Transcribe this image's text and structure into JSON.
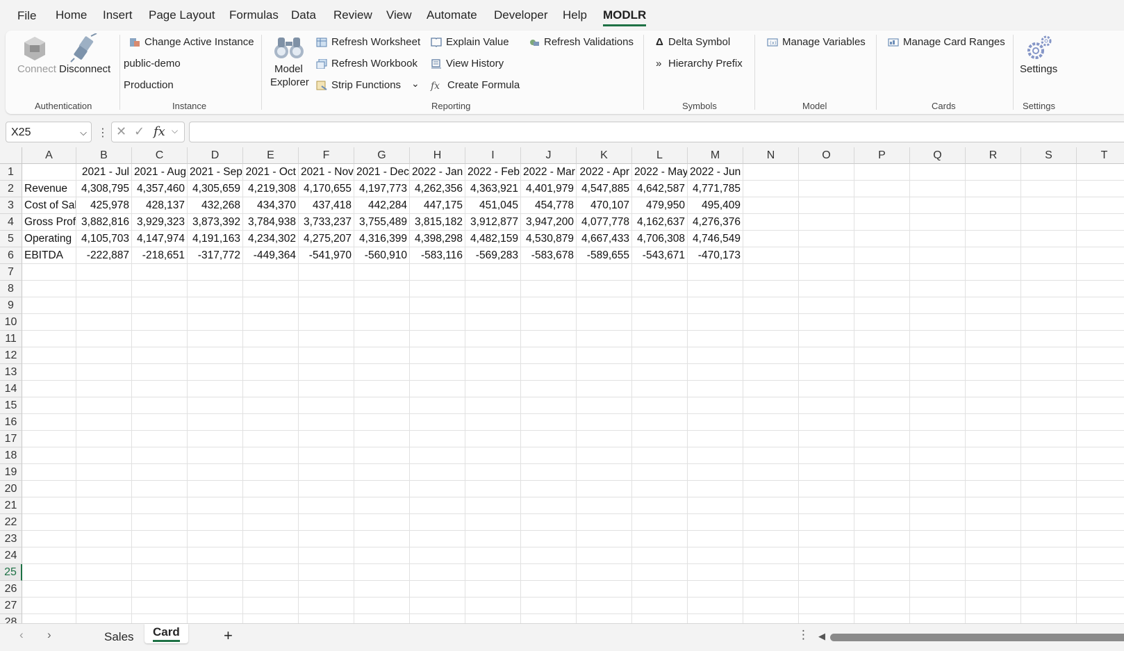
{
  "menu": {
    "items": [
      "File",
      "Home",
      "Insert",
      "Page Layout",
      "Formulas",
      "Data",
      "Review",
      "View",
      "Automate",
      "Developer",
      "Help",
      "MODLR"
    ],
    "active": "MODLR"
  },
  "ribbon": {
    "auth": {
      "connect": "Connect",
      "disconnect": "Disconnect",
      "label": "Authentication"
    },
    "instance": {
      "change": "Change Active Instance",
      "name": "public-demo",
      "env": "Production",
      "label": "Instance"
    },
    "reporting": {
      "model_explorer_1": "Model",
      "model_explorer_2": "Explorer",
      "refresh_worksheet": "Refresh Worksheet",
      "refresh_workbook": "Refresh Workbook",
      "strip_functions": "Strip Functions",
      "explain_value": "Explain Value",
      "view_history": "View History",
      "create_formula": "Create Formula",
      "refresh_validations": "Refresh Validations",
      "label": "Reporting"
    },
    "symbols": {
      "delta": "Delta Symbol",
      "hierarchy": "Hierarchy Prefix",
      "label": "Symbols"
    },
    "model": {
      "manage_variables": "Manage Variables",
      "label": "Model"
    },
    "cards": {
      "manage_card_ranges": "Manage Card Ranges",
      "label": "Cards"
    },
    "settings": {
      "settings": "Settings",
      "label": "Settings"
    }
  },
  "formula_bar": {
    "name_box": "X25",
    "fx": "fx",
    "value": ""
  },
  "sheet": {
    "columns": [
      "A",
      "B",
      "C",
      "D",
      "E",
      "F",
      "G",
      "H",
      "I",
      "J",
      "K",
      "L",
      "M",
      "N",
      "O",
      "P",
      "Q",
      "R",
      "S",
      "T"
    ],
    "rows": [
      "1",
      "2",
      "3",
      "4",
      "5",
      "6",
      "7",
      "8",
      "9",
      "10",
      "11",
      "12",
      "13",
      "14",
      "15",
      "16",
      "17",
      "18",
      "19",
      "20",
      "21",
      "22",
      "23",
      "24",
      "25",
      "26",
      "27",
      "28"
    ],
    "header_row": [
      "",
      "2021 - Jul",
      "2021 - Aug",
      "2021 - Sep",
      "2021 - Oct",
      "2021 - Nov",
      "2021 - Dec",
      "2022 - Jan",
      "2022 - Feb",
      "2022 - Mar",
      "2022 - Apr",
      "2022 - May",
      "2022 - Jun"
    ],
    "data": [
      [
        "Revenue",
        "4,308,795",
        "4,357,460",
        "4,305,659",
        "4,219,308",
        "4,170,655",
        "4,197,773",
        "4,262,356",
        "4,363,921",
        "4,401,979",
        "4,547,885",
        "4,642,587",
        "4,771,785"
      ],
      [
        "Cost of Sal",
        "425,978",
        "428,137",
        "432,268",
        "434,370",
        "437,418",
        "442,284",
        "447,175",
        "451,045",
        "454,778",
        "470,107",
        "479,950",
        "495,409"
      ],
      [
        "Gross Prof",
        "3,882,816",
        "3,929,323",
        "3,873,392",
        "3,784,938",
        "3,733,237",
        "3,755,489",
        "3,815,182",
        "3,912,877",
        "3,947,200",
        "4,077,778",
        "4,162,637",
        "4,276,376"
      ],
      [
        "Operating",
        "4,105,703",
        "4,147,974",
        "4,191,163",
        "4,234,302",
        "4,275,207",
        "4,316,399",
        "4,398,298",
        "4,482,159",
        "4,530,879",
        "4,667,433",
        "4,706,308",
        "4,746,549"
      ],
      [
        "EBITDA",
        "-222,887",
        "-218,651",
        "-317,772",
        "-449,364",
        "-541,970",
        "-560,910",
        "-583,116",
        "-569,283",
        "-583,678",
        "-589,655",
        "-543,671",
        "-470,173"
      ]
    ],
    "active_cell": "X25"
  },
  "tabs": {
    "items": [
      "Sales",
      "Card"
    ],
    "active": "Card",
    "add": "+"
  },
  "colors": {
    "accent": "#1e7145"
  }
}
